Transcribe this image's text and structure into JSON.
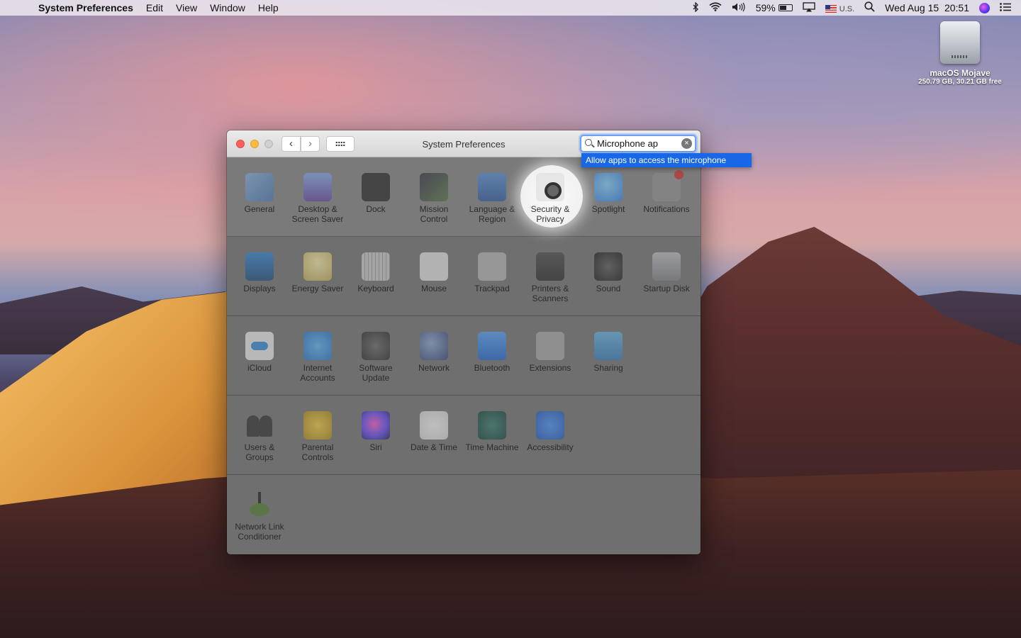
{
  "menubar": {
    "apple": "",
    "app_name": "System Preferences",
    "menus": [
      "Edit",
      "View",
      "Window",
      "Help"
    ],
    "battery_percent": "59%",
    "battery_level": 0.59,
    "input_source": "U.S.",
    "datetime": "Wed Aug 15  20:51",
    "icons": [
      "bluetooth-icon",
      "wifi-icon",
      "volume-icon",
      "battery-icon",
      "airplay-icon",
      "flag-icon",
      "spotlight-icon",
      "siri-icon",
      "notification-center-icon"
    ]
  },
  "desktop": {
    "drive_name": "macOS Mojave",
    "drive_size": "250.79 GB, 30.21 GB free"
  },
  "window": {
    "title": "System Preferences",
    "nav_back": "‹",
    "nav_forward": "›",
    "search": {
      "value": "Microphone ap",
      "clear": "×"
    },
    "suggestion": "Allow apps to access the microphone",
    "rows": [
      [
        {
          "label": "General",
          "icon": "general-icon"
        },
        {
          "label": "Desktop & Screen Saver",
          "icon": "desktop-icon"
        },
        {
          "label": "Dock",
          "icon": "dock-icon"
        },
        {
          "label": "Mission Control",
          "icon": "mission-control-icon"
        },
        {
          "label": "Language & Region",
          "icon": "language-region-icon"
        },
        {
          "label": "Security & Privacy",
          "icon": "security-privacy-icon"
        },
        {
          "label": "Spotlight",
          "icon": "spotlight-icon"
        },
        {
          "label": "Notifications",
          "icon": "notifications-icon"
        }
      ],
      [
        {
          "label": "Displays",
          "icon": "displays-icon"
        },
        {
          "label": "Energy Saver",
          "icon": "energy-saver-icon"
        },
        {
          "label": "Keyboard",
          "icon": "keyboard-icon"
        },
        {
          "label": "Mouse",
          "icon": "mouse-icon"
        },
        {
          "label": "Trackpad",
          "icon": "trackpad-icon"
        },
        {
          "label": "Printers & Scanners",
          "icon": "printers-icon"
        },
        {
          "label": "Sound",
          "icon": "sound-icon"
        },
        {
          "label": "Startup Disk",
          "icon": "startup-disk-icon"
        }
      ],
      [
        {
          "label": "iCloud",
          "icon": "icloud-icon"
        },
        {
          "label": "Internet Accounts",
          "icon": "internet-accounts-icon"
        },
        {
          "label": "Software Update",
          "icon": "software-update-icon"
        },
        {
          "label": "Network",
          "icon": "network-icon"
        },
        {
          "label": "Bluetooth",
          "icon": "bluetooth-icon"
        },
        {
          "label": "Extensions",
          "icon": "extensions-icon"
        },
        {
          "label": "Sharing",
          "icon": "sharing-icon"
        }
      ],
      [
        {
          "label": "Users & Groups",
          "icon": "users-groups-icon"
        },
        {
          "label": "Parental Controls",
          "icon": "parental-controls-icon"
        },
        {
          "label": "Siri",
          "icon": "siri-icon"
        },
        {
          "label": "Date & Time",
          "icon": "date-time-icon"
        },
        {
          "label": "Time Machine",
          "icon": "time-machine-icon"
        },
        {
          "label": "Accessibility",
          "icon": "accessibility-icon"
        }
      ],
      [
        {
          "label": "Network Link Conditioner",
          "icon": "network-link-conditioner-icon"
        }
      ]
    ]
  }
}
